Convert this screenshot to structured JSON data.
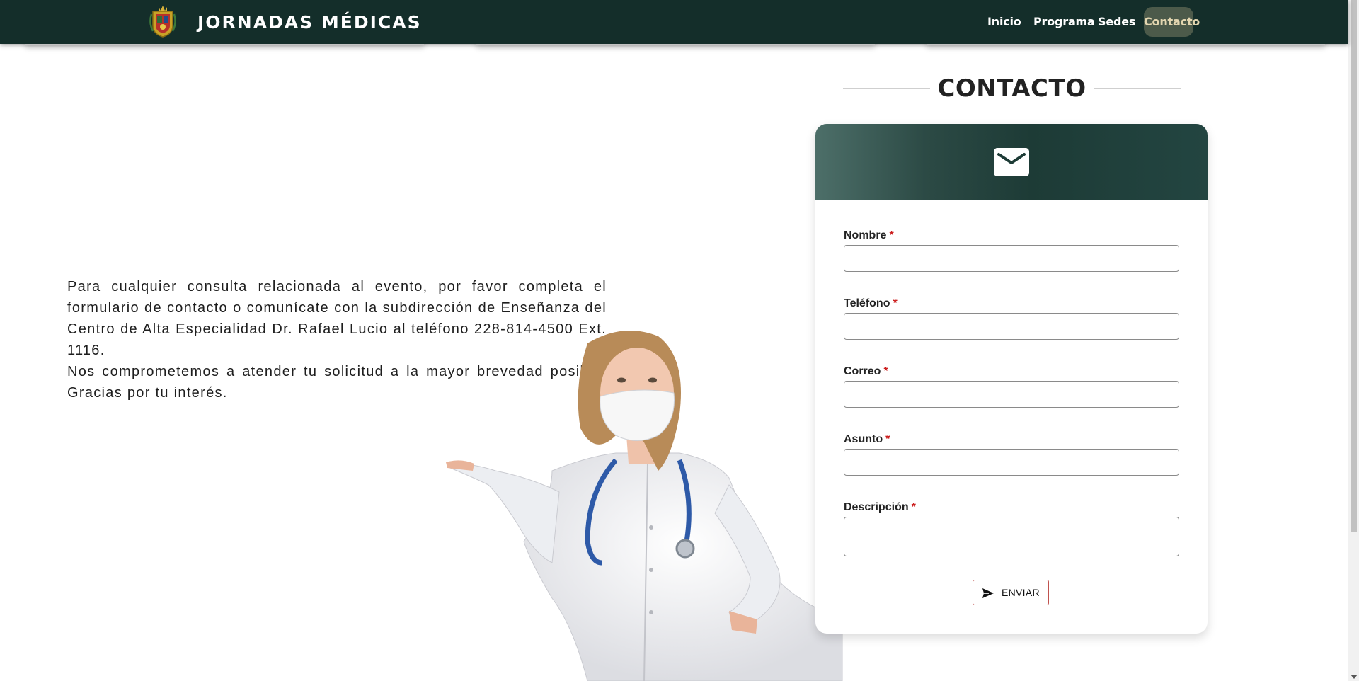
{
  "navbar": {
    "brand": "JORNADAS MÉDICAS",
    "links": [
      "Inicio",
      "Programa",
      "Sedes",
      "Contacto"
    ],
    "active_link": "Contacto"
  },
  "info": {
    "paragraph1": "Para cualquier consulta relacionada al evento, por favor completa el formulario de contacto o comunícate con la subdirección de Enseñanza del Centro de Alta Especialidad Dr. Rafael Lucio al teléfono 228-814-4500 Ext. 1116.",
    "paragraph2": "Nos comprometemos a atender tu solicitud a la mayor brevedad posible. Gracias por tu interés."
  },
  "contact": {
    "title": "CONTACTO",
    "header_icon": "envelope-icon",
    "fields": [
      {
        "label": "Nombre",
        "required_mark": "*",
        "value": "",
        "type": "text"
      },
      {
        "label": "Teléfono",
        "required_mark": "*",
        "value": "",
        "type": "text"
      },
      {
        "label": "Correo",
        "required_mark": "*",
        "value": "",
        "type": "text"
      },
      {
        "label": "Asunto",
        "required_mark": "*",
        "value": "",
        "type": "text"
      },
      {
        "label": "Descripción",
        "required_mark": "*",
        "value": "",
        "type": "textarea"
      }
    ],
    "submit": {
      "label": "ENVIAR",
      "icon": "send-icon"
    }
  },
  "colors": {
    "navbar": "#142e2a",
    "active_link_bg": "#4c5a4a",
    "active_link_text": "#e3d6b0",
    "form_header": "#1d3b36",
    "required": "#cc1f1f",
    "send_border": "#c0524e"
  }
}
